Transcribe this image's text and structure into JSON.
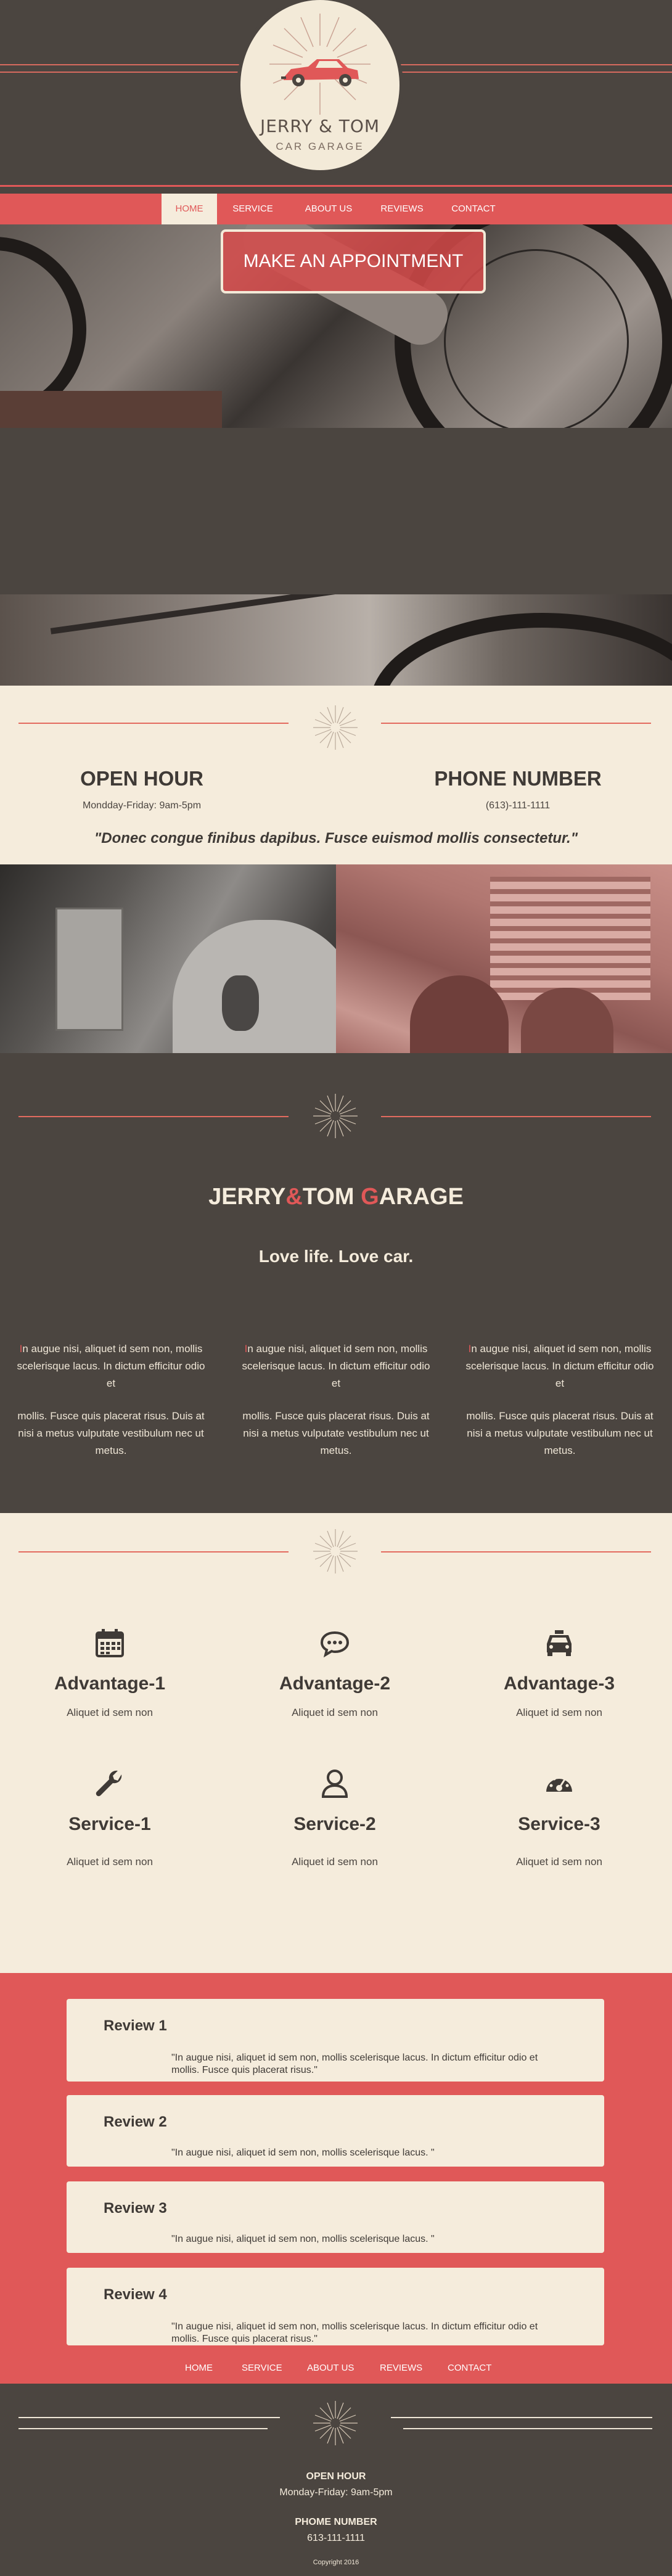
{
  "logo": {
    "title": "JERRY & TOM",
    "subtitle": "CAR GARAGE"
  },
  "colors": {
    "dark": "#4b4540",
    "cream": "#f5ecdc",
    "accent": "#e05858"
  },
  "nav": [
    {
      "label": "HOME",
      "active": true
    },
    {
      "label": "SERVICE"
    },
    {
      "label": "ABOUT US"
    },
    {
      "label": "REVIEWS"
    },
    {
      "label": "CONTACT"
    }
  ],
  "hero": {
    "cta": "MAKE AN APPOINTMENT"
  },
  "info": {
    "open_title": "OPEN HOUR",
    "open_text": "Mondday-Friday: 9am-5pm",
    "phone_title": "PHONE NUMBER",
    "phone_text": "(613)-111-1111",
    "quote": "\"Donec congue finibus dapibus. Fusce euismod mollis consectetur.\""
  },
  "about": {
    "title_a": "JERRY",
    "title_b": "&",
    "title_c": "TOM ",
    "title_d": "G",
    "title_e": "ARAGE",
    "subtitle": "Love life. Love car.",
    "columns": [
      {
        "first": "I",
        "p1": "n augue nisi, aliquet id sem non, mollis scelerisque lacus. In dictum efficitur odio et",
        "p2": "mollis. Fusce quis placerat risus. Duis at nisi a metus vulputate vestibulum nec ut metus."
      },
      {
        "first": "I",
        "p1": "n augue nisi, aliquet id sem non, mollis scelerisque lacus. In dictum efficitur odio et",
        "p2": "mollis. Fusce quis placerat risus. Duis at nisi a metus vulputate vestibulum nec ut metus."
      },
      {
        "first": "I",
        "p1": "n augue nisi, aliquet id sem non, mollis scelerisque lacus. In dictum efficitur odio et",
        "p2": "mollis. Fusce quis placerat risus. Duis at nisi a metus vulputate vestibulum nec ut metus."
      }
    ]
  },
  "advantages": [
    {
      "icon": "calendar-icon",
      "title": "Advantage-1",
      "text": "Aliquet id sem non"
    },
    {
      "icon": "chat-bubble-icon",
      "title": "Advantage-2",
      "text": "Aliquet id sem non"
    },
    {
      "icon": "taxi-icon",
      "title": "Advantage-3",
      "text": "Aliquet id sem non"
    },
    {
      "icon": "wrench-icon",
      "title": "Service-1",
      "text": "Aliquet id sem non"
    },
    {
      "icon": "user-icon",
      "title": "Service-2",
      "text": "Aliquet id sem non"
    },
    {
      "icon": "dashboard-icon",
      "title": "Service-3",
      "text": "Aliquet id sem non"
    }
  ],
  "reviews": [
    {
      "title": "Review 1",
      "text": "\"In augue nisi, aliquet id sem non, mollis scelerisque lacus. In dictum efficitur odio et mollis. Fusce quis placerat risus.\""
    },
    {
      "title": "Review 2",
      "text": "\"In augue nisi, aliquet id sem non, mollis scelerisque lacus. \""
    },
    {
      "title": "Review 3",
      "text": "\"In augue nisi, aliquet id sem non, mollis scelerisque lacus. \""
    },
    {
      "title": "Review 4",
      "text": "\"In augue nisi, aliquet id sem non, mollis scelerisque lacus. In dictum efficitur odio et mollis. Fusce quis placerat risus.\""
    }
  ],
  "footer_nav": [
    "HOME",
    "SERVICE",
    "ABOUT US",
    "REVIEWS",
    "CONTACT"
  ],
  "footer": {
    "open_title": "OPEN HOUR",
    "open_text": "Monday-Friday: 9am-5pm",
    "phone_title": "PHOME NUMBER",
    "phone_text": "613-111-1111",
    "copyright": "Copyright 2016"
  }
}
